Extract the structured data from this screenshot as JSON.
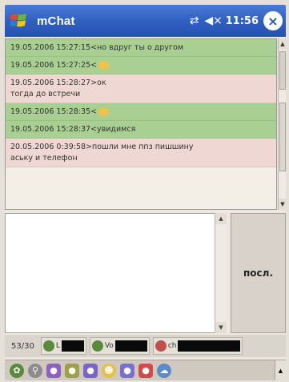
{
  "titlebar": {
    "app_title": "mChat",
    "clock": "11:56"
  },
  "messages": [
    {
      "lines": [
        "19.05.2006 15:27:15<но вдруг ты о другом"
      ],
      "color": "green",
      "smile": false
    },
    {
      "lines": [
        "19.05.2006 15:27:25<"
      ],
      "color": "green",
      "smile": true
    },
    {
      "lines": [
        "19.05.2006 15:28:27>ок",
        "тогда до встречи"
      ],
      "color": "pink",
      "smile": false
    },
    {
      "lines": [
        "19.05.2006 15:28:35<"
      ],
      "color": "green",
      "smile": true
    },
    {
      "lines": [
        "19.05.2006 15:28:37<увидимся"
      ],
      "color": "green",
      "smile": false
    },
    {
      "lines": [
        "20.05.2006 0:39:58>пошли мне ппз пишшину",
        "аську и телефон"
      ],
      "color": "pink",
      "smile": false
    }
  ],
  "send_button": "посл.",
  "status": {
    "counter": "53/30",
    "contacts": [
      {
        "name": "L",
        "icon_color": "#5a8a3c",
        "redact_width": 28
      },
      {
        "name": "Vo",
        "icon_color": "#5a8a3c",
        "redact_width": 40
      },
      {
        "name": "ch",
        "icon_color": "#c0504d",
        "redact_width": 78
      }
    ]
  },
  "toolbar_icons": [
    {
      "name": "flower-icon",
      "cls": "green",
      "glyph": "✿"
    },
    {
      "name": "link-icon",
      "cls": "gray",
      "glyph": "⚲"
    },
    {
      "name": "status-purple-icon",
      "cls": "purple",
      "glyph": "●"
    },
    {
      "name": "status-olive-icon",
      "cls": "olive",
      "glyph": "●"
    },
    {
      "name": "status-violet-icon",
      "cls": "violet",
      "glyph": "●"
    },
    {
      "name": "smile-icon",
      "cls": "yellow",
      "glyph": "☻"
    },
    {
      "name": "status-lavender-icon",
      "cls": "lav",
      "glyph": "●"
    },
    {
      "name": "status-red-icon",
      "cls": "red",
      "glyph": "●"
    },
    {
      "name": "cloud-icon",
      "cls": "cloud",
      "glyph": "☁"
    }
  ]
}
